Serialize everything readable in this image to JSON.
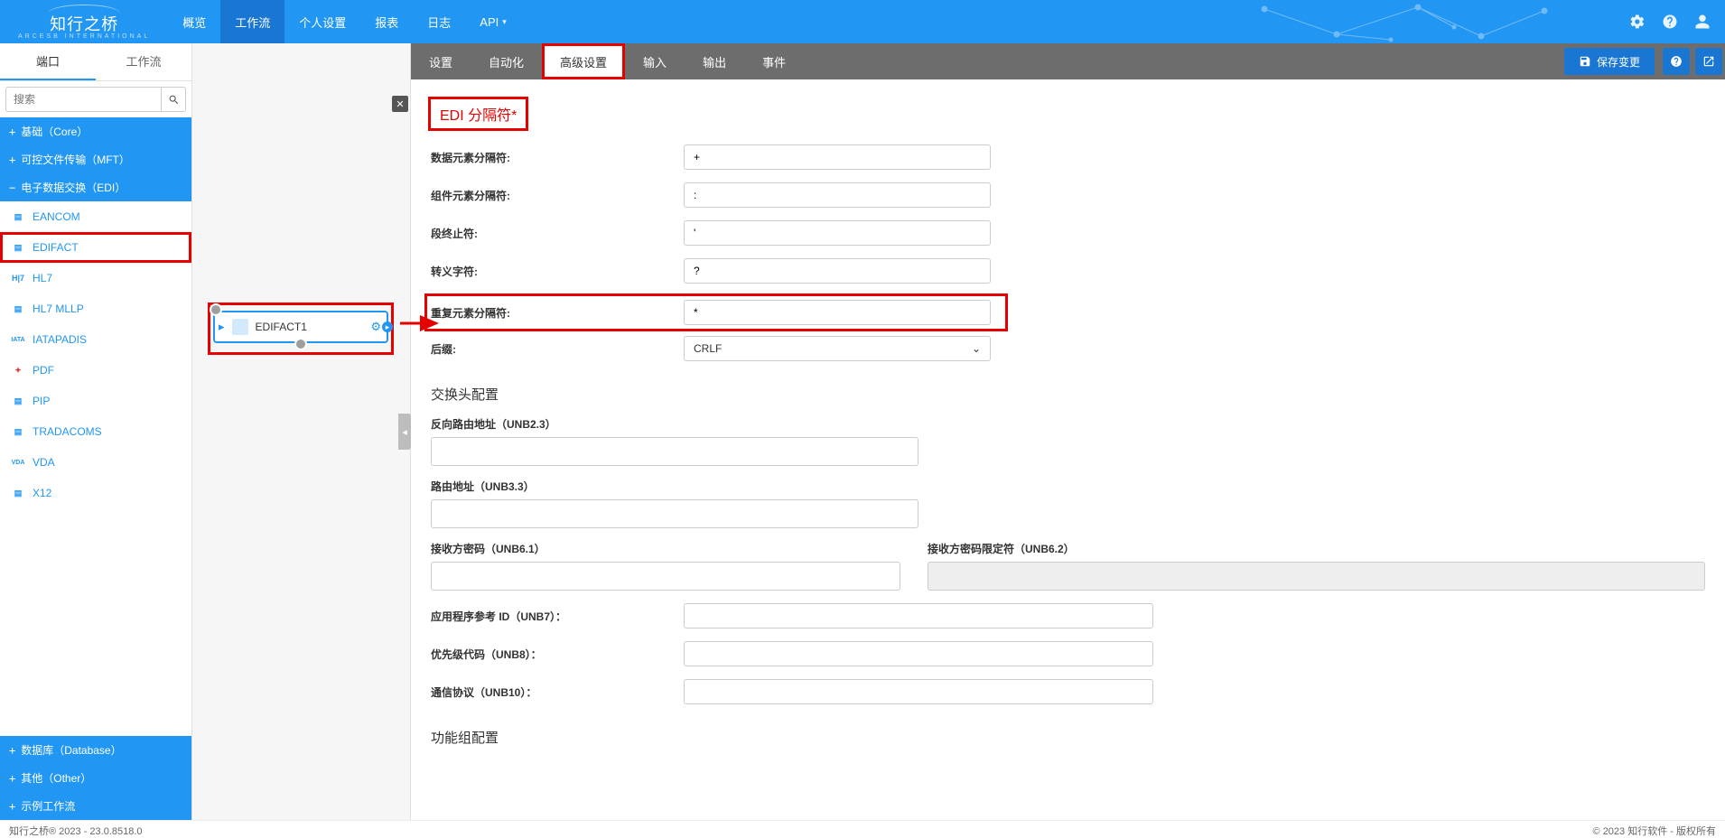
{
  "brand": {
    "name": "知行之桥",
    "sub": "ARCESB INTERNATIONAL"
  },
  "nav": {
    "items": [
      "概览",
      "工作流",
      "个人设置",
      "报表",
      "日志",
      "API"
    ],
    "active": 1,
    "api_has_dropdown": true
  },
  "left": {
    "tabs": [
      "端口",
      "工作流"
    ],
    "active_tab": 0,
    "search_placeholder": "搜索",
    "groups_top": [
      {
        "label": "基础（Core）",
        "expand": "+"
      },
      {
        "label": "可控文件传输（MFT）",
        "expand": "+"
      },
      {
        "label": "电子数据交换（EDI）",
        "expand": "−"
      }
    ],
    "edi_items": [
      {
        "label": "EANCOM",
        "icon_color": "#2196F3"
      },
      {
        "label": "EDIFACT",
        "icon_color": "#2196F3",
        "selected": true
      },
      {
        "label": "HL7",
        "icon_color": "#2196F3"
      },
      {
        "label": "HL7 MLLP",
        "icon_color": "#2196F3"
      },
      {
        "label": "IATAPADIS",
        "icon_color": "#2196F3"
      },
      {
        "label": "PDF",
        "icon_color": "#E53935"
      },
      {
        "label": "PIP",
        "icon_color": "#2196F3"
      },
      {
        "label": "TRADACOMS",
        "icon_color": "#2196F3"
      },
      {
        "label": "VDA",
        "icon_color": "#2196F3"
      },
      {
        "label": "X12",
        "icon_color": "#2196F3"
      }
    ],
    "groups_bottom": [
      {
        "label": "数据库（Database）",
        "expand": "+"
      },
      {
        "label": "其他（Other）",
        "expand": "+"
      },
      {
        "label": "示例工作流",
        "expand": "+"
      }
    ]
  },
  "flow": {
    "node_label": "EDIFACT1"
  },
  "rightTabs": {
    "items": [
      "设置",
      "自动化",
      "高级设置",
      "输入",
      "输出",
      "事件"
    ],
    "active": 2
  },
  "saveLabel": "保存变更",
  "form": {
    "section1_title": "EDI 分隔符*",
    "rows1": [
      {
        "label": "数据元素分隔符:",
        "value": "+"
      },
      {
        "label": "组件元素分隔符:",
        "value": ":"
      },
      {
        "label": "段终止符:",
        "value": "'"
      },
      {
        "label": "转义字符:",
        "value": "?"
      }
    ],
    "repeat_row": {
      "label": "重复元素分隔符:",
      "value": "*"
    },
    "suffix_row": {
      "label": "后缀:",
      "value": "CRLF"
    },
    "section2_title": "交换头配置",
    "stack2": [
      {
        "label": "反向路由地址（UNB2.3）",
        "value": ""
      },
      {
        "label": "路由地址（UNB3.3）",
        "value": ""
      }
    ],
    "pw_pair": {
      "left": {
        "label": "接收方密码（UNB6.1）",
        "value": ""
      },
      "right": {
        "label": "接收方密码限定符（UNB6.2）",
        "value": "",
        "disabled": true
      }
    },
    "rows2": [
      {
        "label": "应用程序参考 ID（UNB7）：",
        "value": ""
      },
      {
        "label": "优先级代码（UNB8）：",
        "value": ""
      },
      {
        "label": "通信协议（UNB10）：",
        "value": ""
      }
    ],
    "section3_title": "功能组配置"
  },
  "footer": {
    "left": "知行之桥® 2023 - 23.0.8518.0",
    "right": "© 2023 知行软件 - 版权所有"
  }
}
